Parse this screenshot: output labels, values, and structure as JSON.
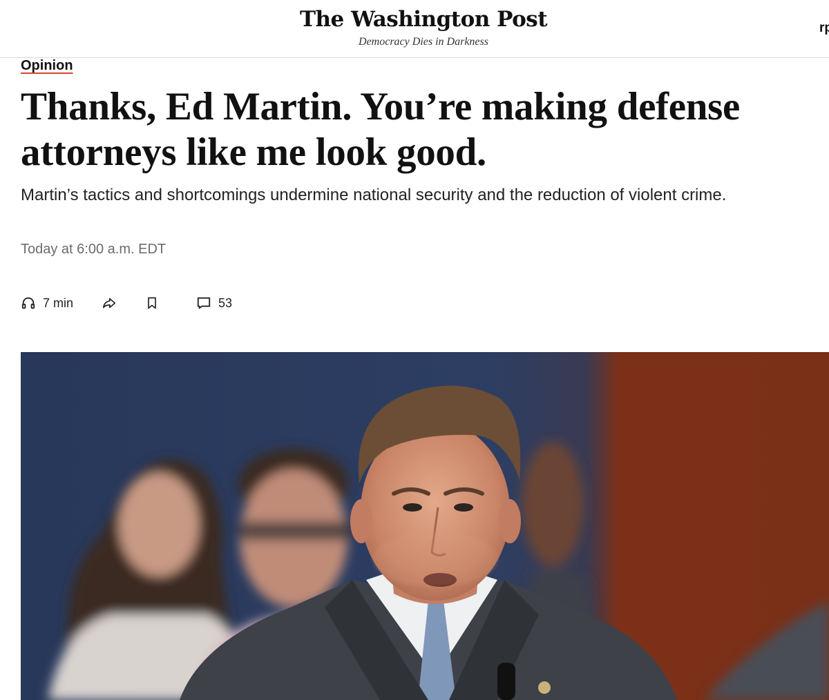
{
  "masthead": {
    "logo": "The Washington Post",
    "tagline": "Democracy Dies in Darkness",
    "edge_text": "rp"
  },
  "article": {
    "kicker": "Opinion",
    "headline": "Thanks, Ed Martin. You’re making defense attorneys like me look good.",
    "dek": "Martin’s tactics and shortcomings undermine national security and the reduction of violent crime.",
    "timestamp": "Today at 6:00 a.m. EDT"
  },
  "tools": {
    "listen_label": "7 min",
    "comments_count": "53"
  },
  "icons": {
    "listen": "headphones-icon",
    "share": "share-arrow-icon",
    "save": "bookmark-icon",
    "comments": "comment-bubble-icon"
  }
}
